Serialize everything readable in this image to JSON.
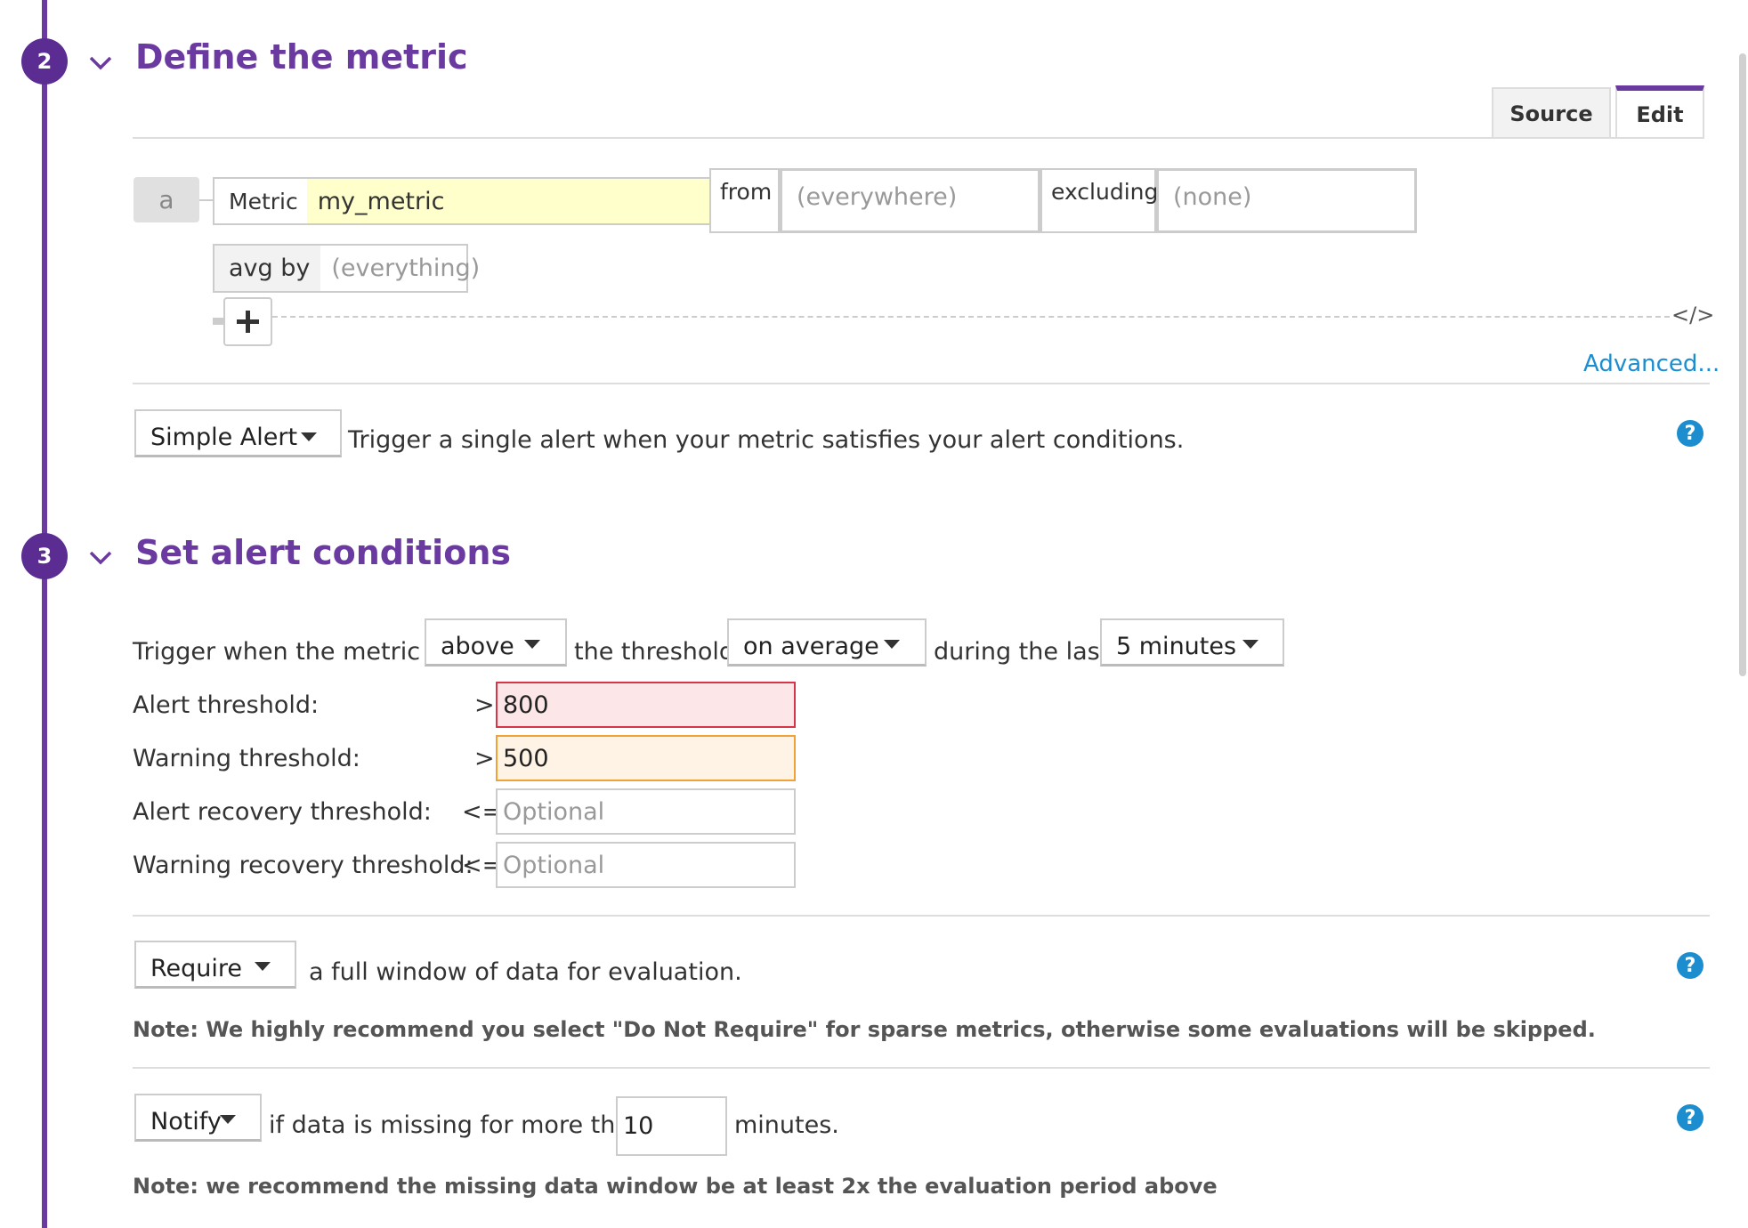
{
  "colors": {
    "accent": "#6a3aa1",
    "link": "#1c8ecf",
    "alert_bg": "#fde6e8",
    "alert_border": "#d6354a",
    "warning_bg": "#fff3e6",
    "warning_border": "#f0a236",
    "metric_bg": "#ffffcc"
  },
  "section2": {
    "step": "2",
    "title": "Define the metric",
    "chevron_icon": "chevron-down-icon",
    "tabs": [
      {
        "label": "Source"
      },
      {
        "label": "Edit"
      }
    ],
    "query": {
      "letter": "a",
      "metric_label": "Metric",
      "metric_value": "my_metric",
      "from_label": "from",
      "from_placeholder": "(everywhere)",
      "excluding_label": "excluding",
      "excluding_placeholder": "(none)",
      "avgby_label": "avg by",
      "avgby_placeholder": "(everything)",
      "add_icon": "plus-icon",
      "code_icon": "code-icon",
      "code_glyph": "</>"
    },
    "advanced_link": "Advanced...",
    "alert_type": {
      "value": "Simple Alert",
      "description": "Trigger a single alert when your metric satisfies your alert conditions."
    }
  },
  "section3": {
    "step": "3",
    "title": "Set alert conditions",
    "trigger": {
      "prefix": "Trigger when the metric is",
      "comparison": "above",
      "middle": "the threshold",
      "aggregation": "on average",
      "suffix": "during the last",
      "window": "5 minutes"
    },
    "thresholds": [
      {
        "label": "Alert threshold:",
        "op": ">",
        "value": "800"
      },
      {
        "label": "Warning threshold:",
        "op": ">",
        "value": "500"
      },
      {
        "label": "Alert recovery threshold:",
        "op": "<=",
        "placeholder": "Optional"
      },
      {
        "label": "Warning recovery threshold:",
        "op": "<=",
        "placeholder": "Optional"
      }
    ],
    "require": {
      "value": "Require",
      "text": "a full window of data for evaluation.",
      "note": "Note: We highly recommend you select \"Do Not Require\" for sparse metrics, otherwise some evaluations will be skipped."
    },
    "notify": {
      "value": "Notify",
      "text_before": "if data is missing for more than",
      "minutes": "10",
      "text_after": "minutes.",
      "note": "Note: we recommend the missing data window be at least 2x the evaluation period above"
    },
    "help_glyph": "?"
  }
}
